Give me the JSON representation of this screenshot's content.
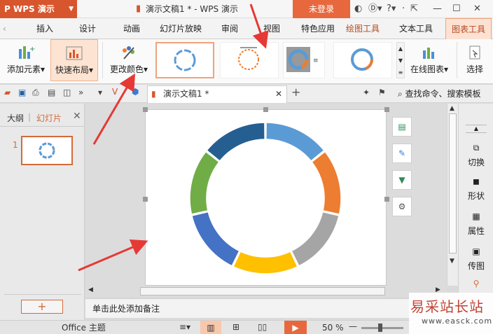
{
  "titlebar": {
    "app_name": "WPS 演示",
    "doc_title": "演示文稿1 * - WPS 演示",
    "login": "未登录"
  },
  "tabs": [
    "插入",
    "设计",
    "动画",
    "幻灯片放映",
    "审阅",
    "视图",
    "特色应用",
    "绘图工具",
    "文本工具",
    "图表工具"
  ],
  "ribbon": {
    "add_element": "添加元素",
    "quick_layout": "快速布局",
    "change_color": "更改颜色",
    "online_chart": "在线图表",
    "select": "选择"
  },
  "doc_tab": {
    "name": "演示文稿1 *"
  },
  "search": {
    "label": "查找命令、搜索模板"
  },
  "leftpane": {
    "outline": "大纲",
    "slides": "幻灯片",
    "slide_number": "1",
    "add": "+"
  },
  "rightpane": {
    "items": [
      "切换",
      "形状",
      "属性",
      "传图"
    ]
  },
  "notes": {
    "placeholder": "单击此处添加备注"
  },
  "statusbar": {
    "theme": "Office 主题",
    "zoom": "50 %"
  },
  "watermark": {
    "line1": "易采站长站",
    "line2": "www.easck.com"
  },
  "colors": {
    "accent": "#d8562d",
    "ring": [
      "#5b9bd5",
      "#ed7d31",
      "#a5a5a5",
      "#ffc000",
      "#4472c4",
      "#70ad47",
      "#255e91"
    ]
  }
}
